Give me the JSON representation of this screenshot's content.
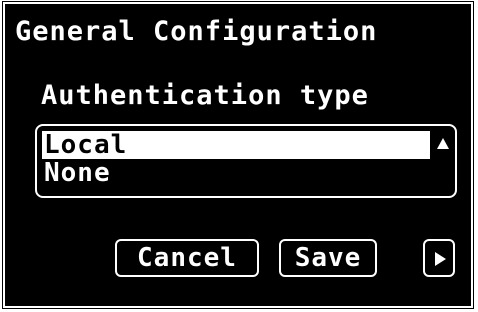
{
  "screen": {
    "title": "General Configuration",
    "subtitle": "Authentication type"
  },
  "auth_list": {
    "items": [
      {
        "label": "Local",
        "selected": true
      },
      {
        "label": "None",
        "selected": false
      }
    ],
    "scroll_icon": "scroll-up-arrow-icon"
  },
  "buttons": {
    "cancel_label": "Cancel",
    "save_label": "Save",
    "next_icon": "play-arrow-icon"
  },
  "colors": {
    "background": "#000000",
    "foreground": "#ffffff"
  }
}
